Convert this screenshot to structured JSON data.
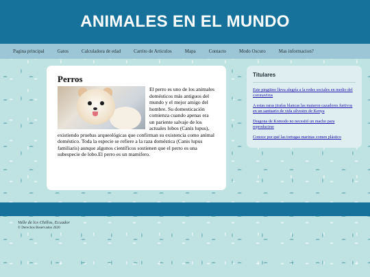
{
  "header": {
    "title": "ANIMALES EN EL MUNDO"
  },
  "nav": {
    "items": [
      "Pagina principal",
      "Gatos",
      "Calculadora de edad",
      "Carrito de Articulos",
      "Mapa",
      "Contacto",
      "Modo Oscuro",
      "Mas informacion?"
    ]
  },
  "article": {
    "title": "Perros",
    "image_alt": "perro pomerania blanco",
    "body": "El perro es uno de los animales domésticos más antiguos del mundo y el mejor amigo del hombre. Su domesticación comienza cuando apenas era un pariente salvaje de los actuales lobos (Canis lupus), existiendo pruebas arqueológicas que confirman su existencia como animal doméstico. Toda la especie se refiere a la raza doméstica (Canis lupus familiaris) aunque algunos científicos sostienen que el perro es una subespecie de lobo.El perro es un mamifero."
  },
  "sidebar": {
    "title": "Titulares",
    "links": [
      "Este pingüino lleva alegría a la redes sociales en medio del coronavirus",
      "A estas raras jirafas blancas las mataron cazadores furtivos en un santuario de vida silvestre de Kenya",
      "Dragona de Komodo no necesitó un macho para reproducirse",
      "Conoce por qué las tortugas marinas comen plástico"
    ]
  },
  "footer": {
    "place": "Valle de los Chillos, Ecuador",
    "copyright": "© Derechos Reservados 2020"
  },
  "colors": {
    "header_bg": "#17729b",
    "nav_bg": "#9cc6d6",
    "page_bg": "#bfe3e3",
    "link": "#1a0dab"
  }
}
